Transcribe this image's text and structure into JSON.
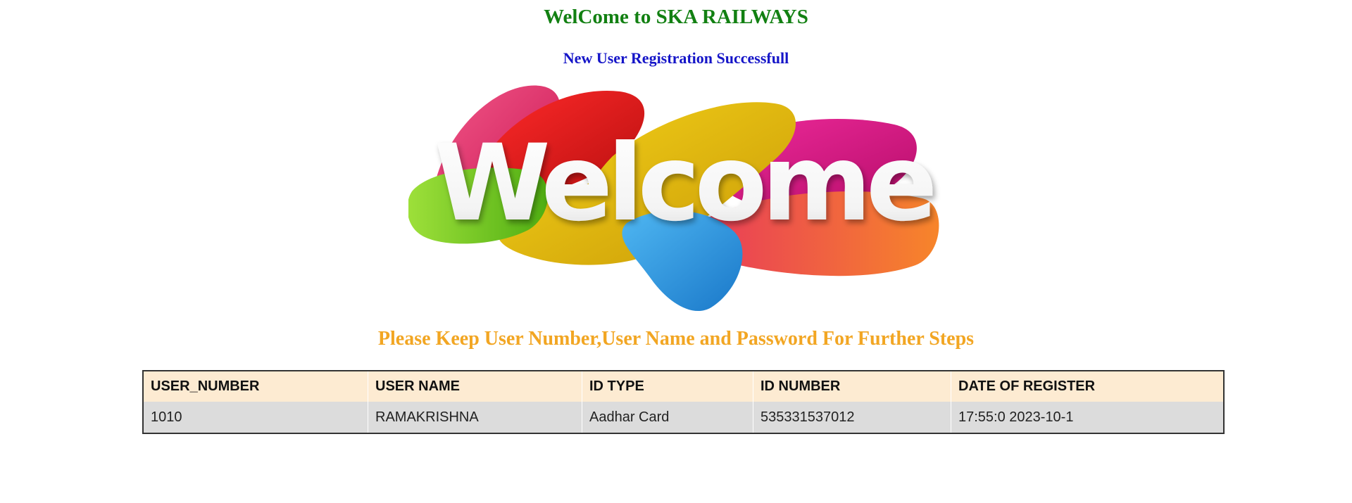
{
  "header": {
    "title": "WelCome to SKA RAILWAYS",
    "subtitle": "New User Registration Successfull"
  },
  "banner": {
    "word": "Welcome",
    "colors": [
      "#e8306a",
      "#e51a1a",
      "#e7c310",
      "#e5158c",
      "#7ccd1e",
      "#2f9fe4",
      "#f25a2a"
    ]
  },
  "notice": "Please Keep User Number,User Name and Password For Further Steps",
  "table": {
    "columns": [
      "USER_NUMBER",
      "USER NAME",
      "ID TYPE",
      "ID NUMBER",
      "DATE OF REGISTER"
    ],
    "rows": [
      [
        "1010",
        "RAMAKRISHNA",
        "Aadhar Card",
        "535331537012",
        "17:55:0 2023-10-1"
      ]
    ]
  }
}
